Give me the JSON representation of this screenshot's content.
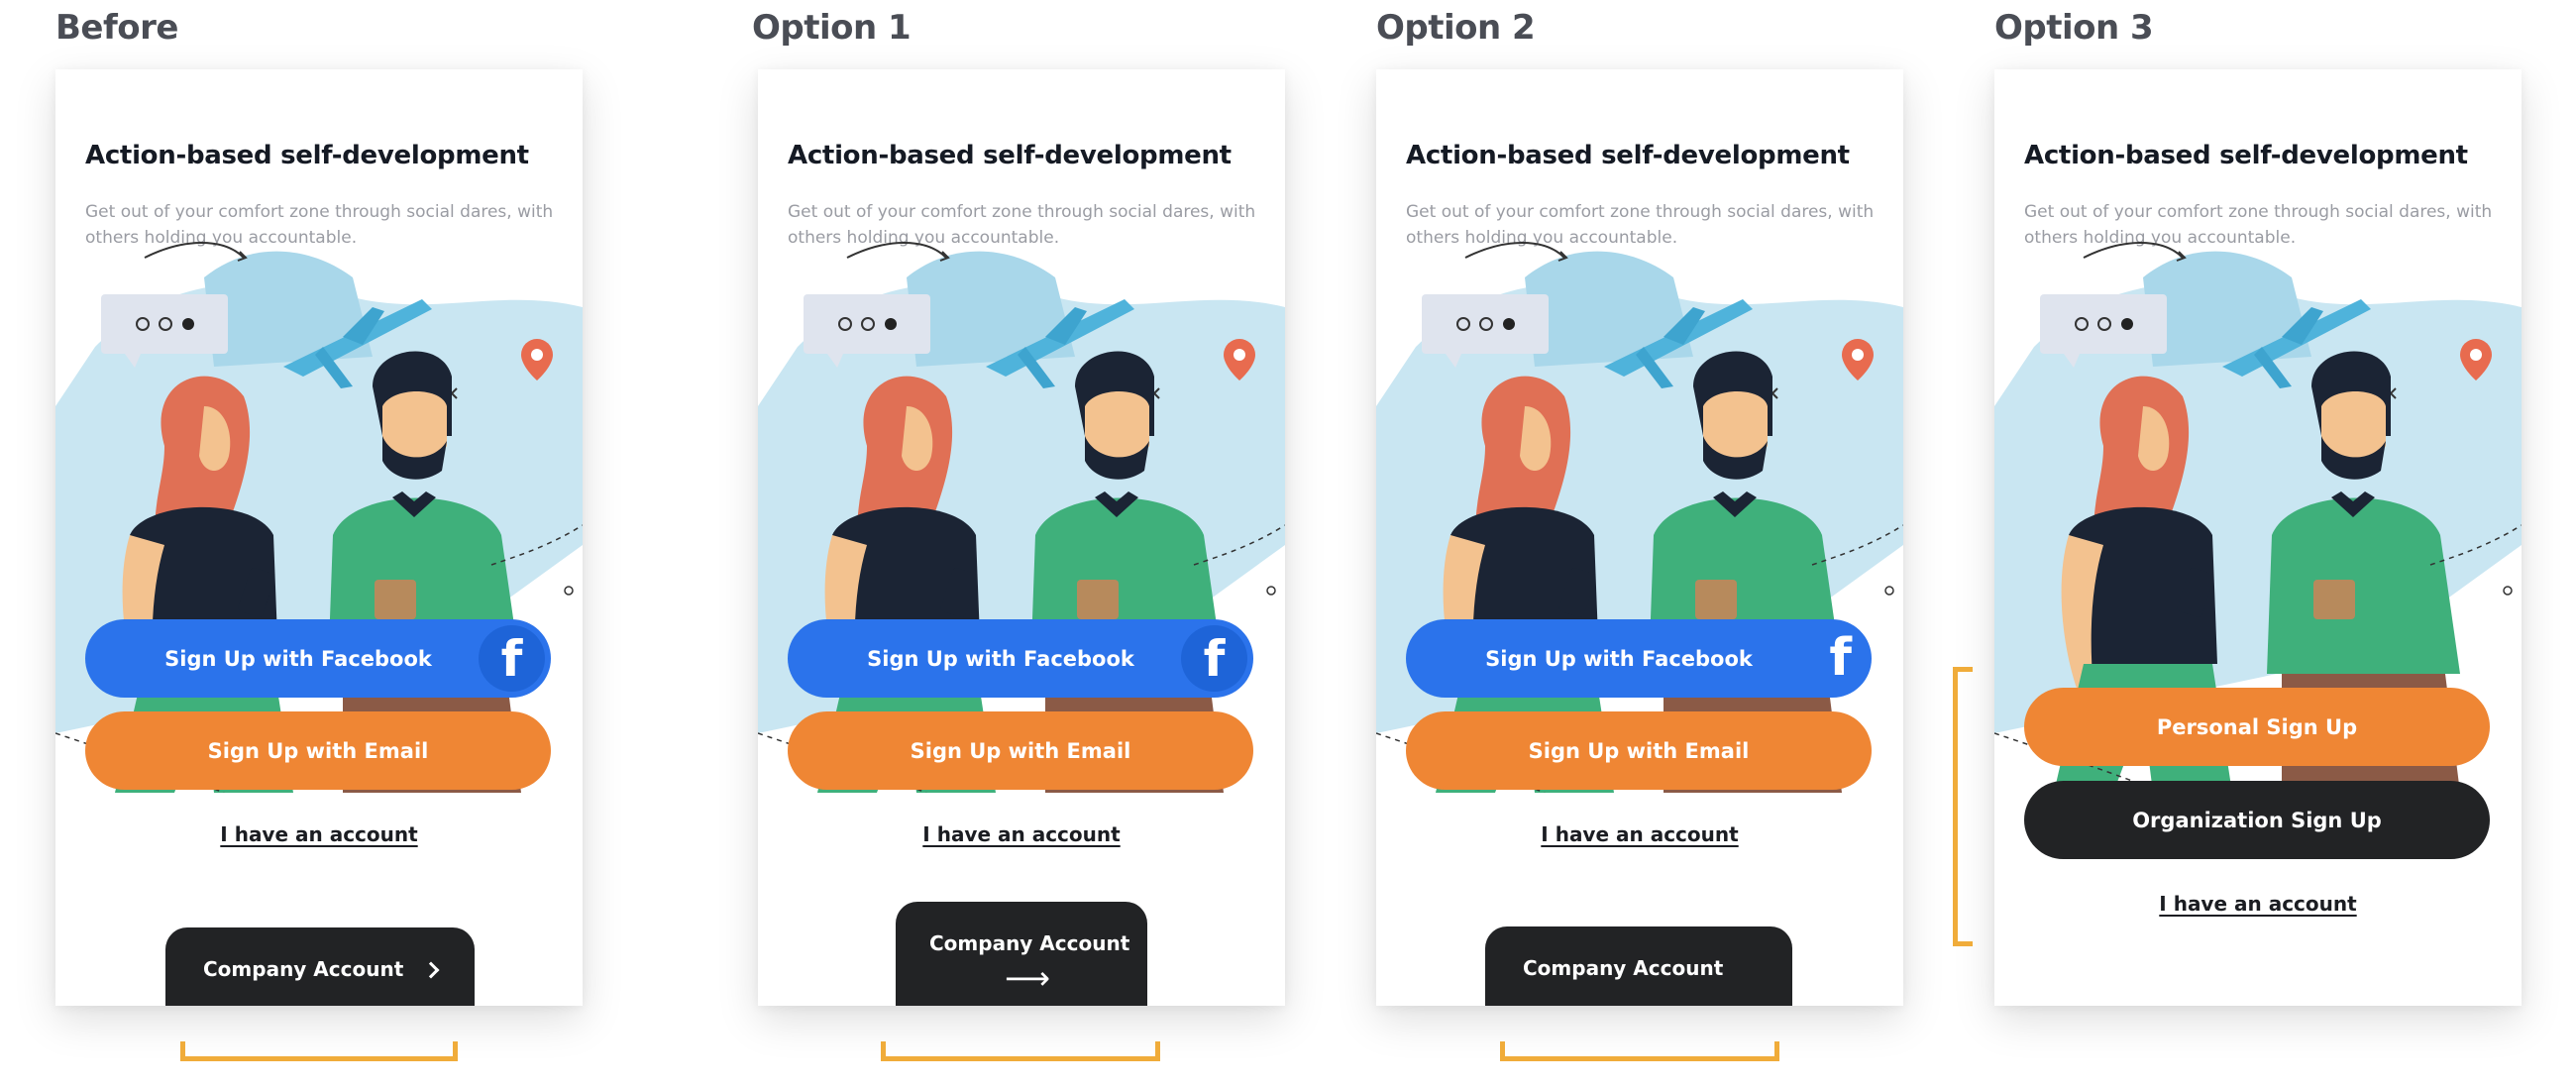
{
  "colors": {
    "facebook": "#2b73eb",
    "orange": "#ef8634",
    "dark": "#222325",
    "bracket": "#f0ac3a"
  },
  "icons": {
    "facebook": "facebook-icon",
    "chevron": "chevron-right-icon",
    "arrow": "arrow-right-icon",
    "illustration": "people-travel-illustration"
  },
  "variants": [
    {
      "label": "Before",
      "title": "Action-based self-development",
      "subtitle": "Get out of your comfort zone through social dares, with others holding you accountable.",
      "facebook_button": "Sign Up with Facebook",
      "facebook_glyph": "f",
      "email_button": "Sign Up with Email",
      "account_link": "I have an account",
      "company_button": "Company Account"
    },
    {
      "label": "Option 1",
      "title": "Action-based self-development",
      "subtitle": "Get out of your comfort zone through social dares, with others holding you accountable.",
      "facebook_button": "Sign Up with Facebook",
      "facebook_glyph": "f",
      "email_button": "Sign Up with Email",
      "account_link": "I have an account",
      "company_button": "Company Account",
      "company_arrow": "⟶"
    },
    {
      "label": "Option 2",
      "title": "Action-based self-development",
      "subtitle": "Get out of your comfort zone through social dares, with others holding you accountable.",
      "facebook_button": "Sign Up with Facebook",
      "facebook_glyph": "f",
      "email_button": "Sign Up with Email",
      "account_link": "I have an account",
      "company_button": "Company Account"
    },
    {
      "label": "Option 3",
      "title": "Action-based self-development",
      "subtitle": "Get out of your comfort zone through social dares, with others holding you accountable.",
      "personal_button": "Personal Sign Up",
      "organization_button": "Organization Sign Up",
      "account_link": "I have an account"
    }
  ]
}
